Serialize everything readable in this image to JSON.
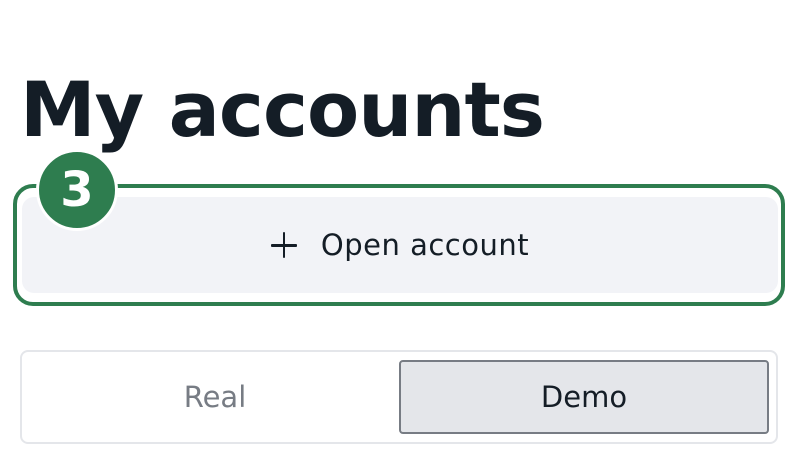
{
  "page": {
    "title": "My accounts"
  },
  "open_account_button": {
    "label": "Open account",
    "icon": "plus-icon"
  },
  "step_badge": {
    "number": "3",
    "color": "#2e7d4f"
  },
  "account_type_toggle": {
    "options": [
      {
        "label": "Real",
        "selected": false
      },
      {
        "label": "Demo",
        "selected": true
      }
    ]
  },
  "colors": {
    "text_primary": "#141d26",
    "text_muted": "#777c84",
    "button_bg": "#f2f3f7",
    "toggle_selected_bg": "#e4e6ea",
    "highlight": "#2e7d4f"
  }
}
